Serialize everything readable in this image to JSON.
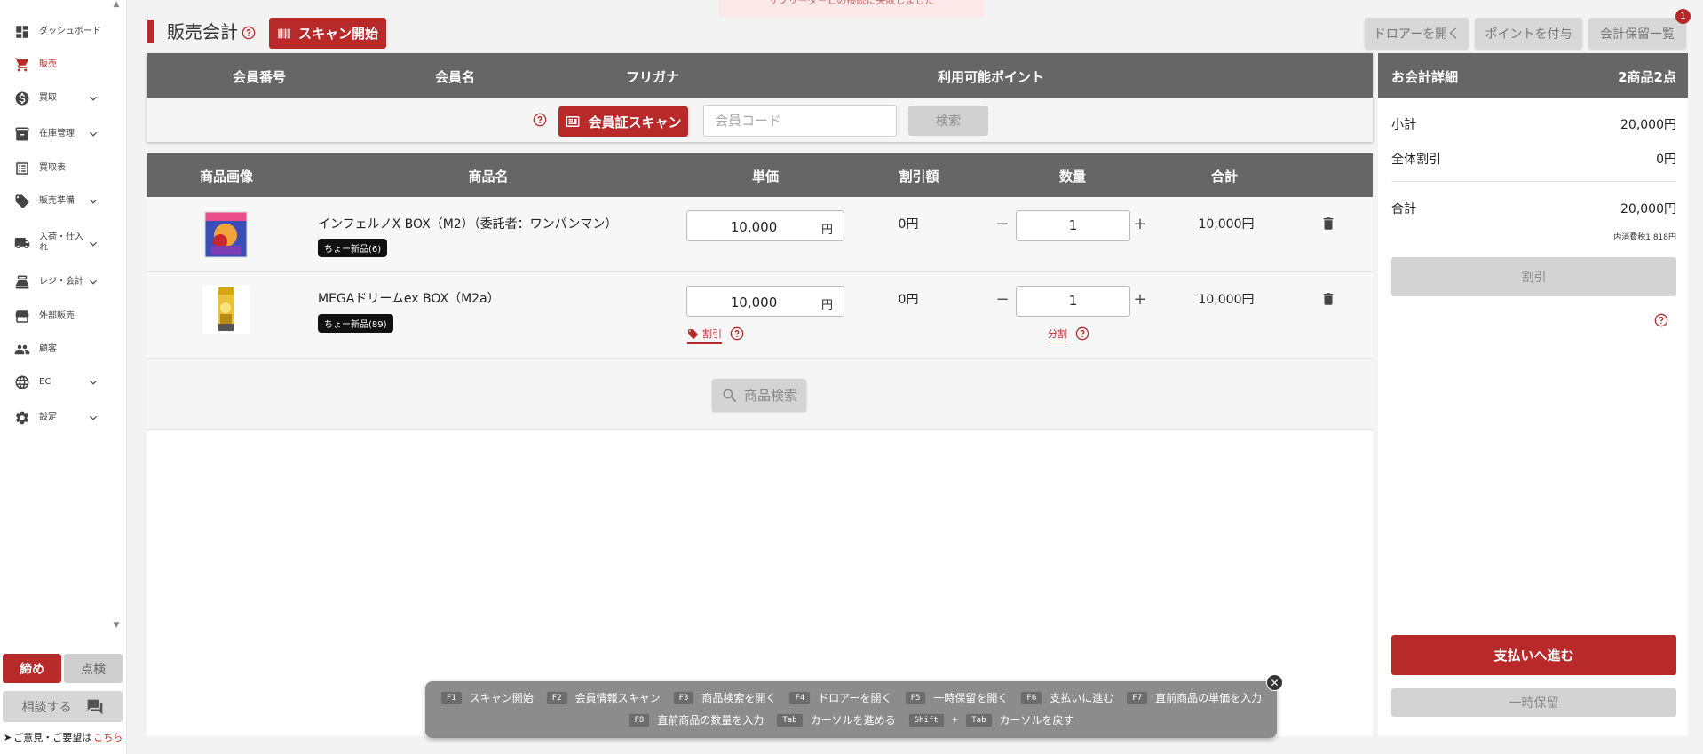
{
  "toast": {
    "text": "サブリーダーとの接続に失敗しました"
  },
  "sidebar": {
    "items": [
      {
        "label": "ダッシュボード",
        "icon": "dashboard-icon"
      },
      {
        "label": "販売",
        "icon": "cart-icon",
        "active": true
      },
      {
        "label": "買取",
        "icon": "dollar-icon"
      },
      {
        "label": "在庫管理",
        "icon": "archive-icon"
      },
      {
        "label": "買取表",
        "icon": "list-icon"
      },
      {
        "label": "販売準備",
        "icon": "tag-icon"
      },
      {
        "label": "入荷・仕入れ",
        "icon": "truck-icon"
      },
      {
        "label": "レジ・会計",
        "icon": "register-icon"
      },
      {
        "label": "外部販売",
        "icon": "store-icon"
      },
      {
        "label": "顧客",
        "icon": "people-icon"
      },
      {
        "label": "EC",
        "icon": "globe-icon"
      },
      {
        "label": "設定",
        "icon": "gear-icon"
      }
    ],
    "close_label": "締め",
    "check_label": "点検",
    "consult_label": "相談する",
    "feedback_text": "ご意見・ご要望は",
    "feedback_link": "こちら"
  },
  "header": {
    "title": "販売会計",
    "scan_label": "スキャン開始",
    "drawer_label": "ドロアーを開く",
    "points_label": "ポイントを付与",
    "holdlist_label": "会計保留一覧",
    "hold_count": "1"
  },
  "member": {
    "columns": [
      "会員番号",
      "会員名",
      "フリガナ",
      "利用可能ポイント"
    ],
    "scan_label": "会員証スキャン",
    "code_placeholder": "会員コード",
    "search_label": "検索"
  },
  "products": {
    "columns": [
      "商品画像",
      "商品名",
      "単価",
      "割引額",
      "数量",
      "合計"
    ],
    "rows": [
      {
        "name": "インフェルノX BOX（M2）（委託者：ワンパンマン）",
        "tag": "ちょー新品(6)",
        "price": "10,000",
        "unit": "円",
        "discount": "0円",
        "qty": "1",
        "total": "10,000円"
      },
      {
        "name": "MEGAドリームex BOX（M2a）",
        "tag": "ちょー新品(89)",
        "price": "10,000",
        "unit": "円",
        "discount": "0円",
        "qty": "1",
        "total": "10,000円",
        "discount_link": "割引",
        "split_link": "分割"
      }
    ],
    "search_label": "商品検索"
  },
  "checkout": {
    "title": "お会計詳細",
    "count": "2商品2点",
    "subtotal_label": "小計",
    "subtotal": "20,000円",
    "all_discount_label": "全体割引",
    "all_discount": "0円",
    "total_label": "合計",
    "total": "20,000円",
    "tax_note": "内消費税1,818円",
    "discount_label": "割引",
    "pay_label": "支払いへ進む",
    "hold_label": "一時保留"
  },
  "shortcuts": {
    "line1": [
      {
        "key": "F1",
        "label": "スキャン開始"
      },
      {
        "key": "F2",
        "label": "会員情報スキャン"
      },
      {
        "key": "F3",
        "label": "商品検索を開く"
      },
      {
        "key": "F4",
        "label": "ドロアーを開く"
      },
      {
        "key": "F5",
        "label": "一時保留を開く"
      },
      {
        "key": "F6",
        "label": "支払いに進む"
      },
      {
        "key": "F7",
        "label": "直前商品の単価を入力"
      }
    ],
    "line2": [
      {
        "key": "F8",
        "label": "直前商品の数量を入力"
      },
      {
        "key": "Tab",
        "label": "カーソルを進める"
      },
      {
        "key": "Shift",
        "key2": "Tab",
        "plus": "+",
        "label": "カーソルを戻す"
      }
    ]
  },
  "colors": {
    "accent": "#b82a2a",
    "header_bg": "#666666"
  }
}
